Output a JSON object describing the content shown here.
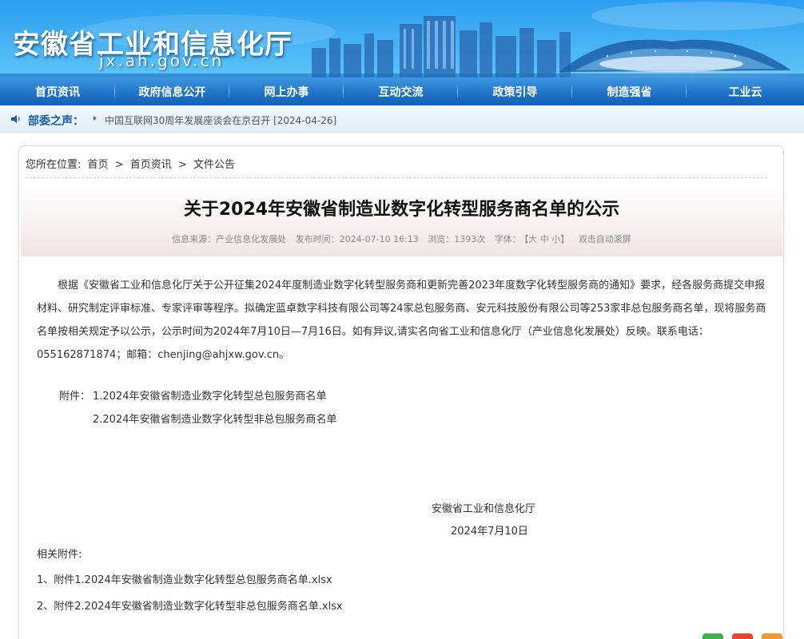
{
  "header": {
    "site_title": "安徽省工业和信息化厅",
    "site_domain": "jx.ah.gov.cn"
  },
  "nav": {
    "items": [
      {
        "label": "首页资讯"
      },
      {
        "label": "政府信息公开"
      },
      {
        "label": "网上办事"
      },
      {
        "label": "互动交流"
      },
      {
        "label": "政策引导"
      },
      {
        "label": "制造强省"
      },
      {
        "label": "工业云"
      }
    ]
  },
  "notice": {
    "label": "部委之声：",
    "text": "中国互联网30周年发展座谈会在京召开 [2024-04-26]"
  },
  "breadcrumb": {
    "prefix": "您所在位置:",
    "items": [
      "首页",
      "首页资讯",
      "文件公告"
    ],
    "separator": ">"
  },
  "article": {
    "title": "关于2024年安徽省制造业数字化转型服务商名单的公示",
    "meta": {
      "source": "信息来源：产业信息化发展处",
      "published": "发布时间：2024-07-10 16:13",
      "views": "浏览：1393次",
      "font_label": "字体：",
      "font_sizes": "【大 中 小】",
      "autoscroll": "双击自动滚屏"
    },
    "body": "根据《安徽省工业和信息化厅关于公开征集2024年度制造业数字化转型服务商和更新完善2023年度数字化转型服务商的通知》要求，经各服务商提交申报材料、研究制定评审标准、专家评审等程序。拟确定蓝卓数字科技有限公司等24家总包服务商、安元科技股份有限公司等253家非总包服务商名单，现将服务商名单按相关规定予以公示，公示时间为2024年7月10日—7月16日。如有异议,请实名向省工业和信息化厅（产业信息化发展处）反映。联系电话：055162871874；邮箱：chenjing@ahjxw.gov.cn。",
    "attachment_label": "附件：",
    "attachments": [
      "1.2024年安徽省制造业数字化转型总包服务商名单",
      "2.2024年安徽省制造业数字化转型非总包服务商名单"
    ],
    "signature_org": "安徽省工业和信息化厅",
    "signature_date": "2024年7月10日",
    "related_label": "相关附件:",
    "related_files": [
      "1、附件1.2024年安徽省制造业数字化转型总包服务商名单.xlsx",
      "2、附件2.2024年安徽省制造业数字化转型非总包服务商名单.xlsx"
    ]
  },
  "colors": {
    "nav_blue": "#1f74c8",
    "notice_label": "#1a5da8",
    "float_green": "#3cb44a",
    "float_red": "#e8452b",
    "float_orange": "#f29a2e"
  }
}
